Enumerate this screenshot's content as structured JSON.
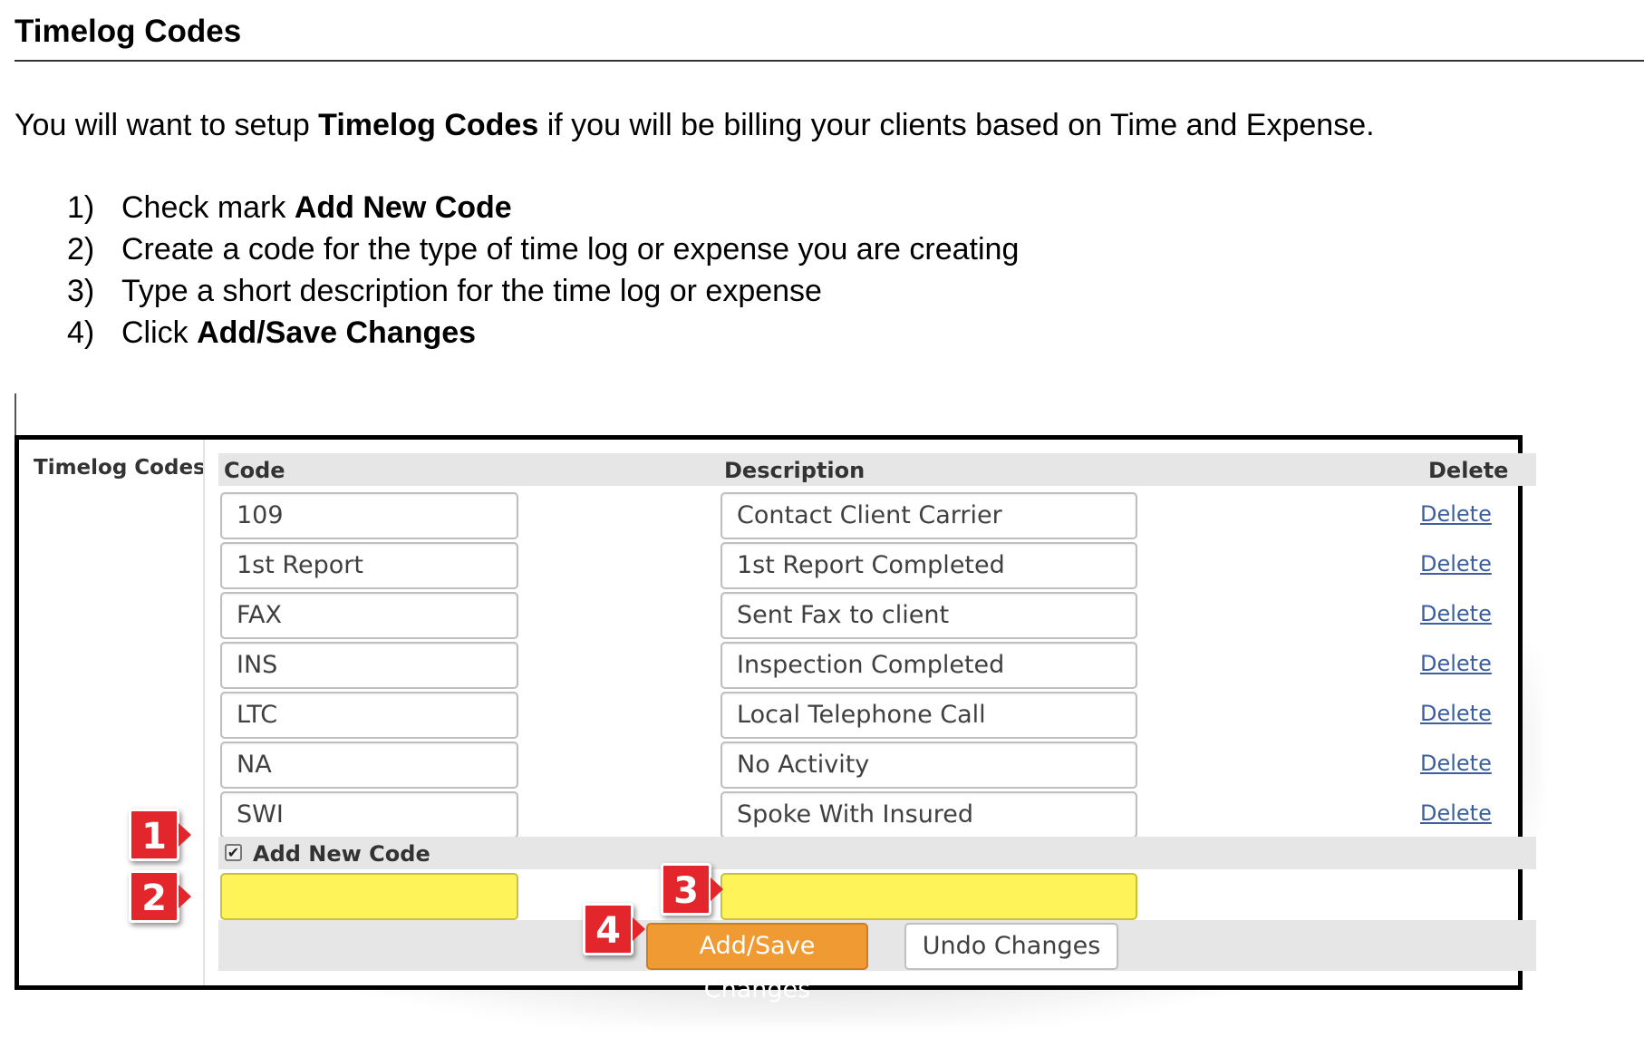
{
  "doc": {
    "heading": "Timelog Codes",
    "intro": {
      "before": "You will want to setup ",
      "bold": "Timelog Codes",
      "after": " if you will be billing your clients based on Time and Expense."
    },
    "steps": [
      {
        "num": "1)",
        "text": "Check mark ",
        "bold": "Add New Code"
      },
      {
        "num": "2)",
        "text": "Create a code for the type of time log or expense you are creating",
        "bold": ""
      },
      {
        "num": "3)",
        "text": "Type a short description for the time log or expense",
        "bold": ""
      },
      {
        "num": "4)",
        "text": "Click ",
        "bold": "Add/Save Changes"
      }
    ]
  },
  "screenshot": {
    "side_label": "Timelog Codes",
    "headers": {
      "code": "Code",
      "description": "Description",
      "delete": "Delete"
    },
    "rows": [
      {
        "code": "109",
        "description": "Contact Client Carrier",
        "delete": "Delete"
      },
      {
        "code": "1st Report",
        "description": "1st Report Completed",
        "delete": "Delete"
      },
      {
        "code": "FAX",
        "description": "Sent Fax to client",
        "delete": "Delete"
      },
      {
        "code": "INS",
        "description": "Inspection Completed",
        "delete": "Delete"
      },
      {
        "code": "LTC",
        "description": "Local Telephone Call",
        "delete": "Delete"
      },
      {
        "code": "NA",
        "description": "No Activity",
        "delete": "Delete"
      },
      {
        "code": "SWI",
        "description": "Spoke With Insured",
        "delete": "Delete"
      }
    ],
    "add_new": {
      "label": "Add New Code",
      "checked": true,
      "check_glyph": "✔"
    },
    "new_code_value": "",
    "new_description_value": "",
    "buttons": {
      "save": "Add/Save Changes",
      "undo": "Undo Changes"
    },
    "badges": [
      "1",
      "2",
      "3",
      "4"
    ],
    "colors": {
      "highlight_yellow": "#fff35a",
      "save_orange": "#ef9a33",
      "badge_red": "#e2262b",
      "link_blue": "#3b5f9f",
      "band_gray": "#e6e6e6"
    }
  }
}
